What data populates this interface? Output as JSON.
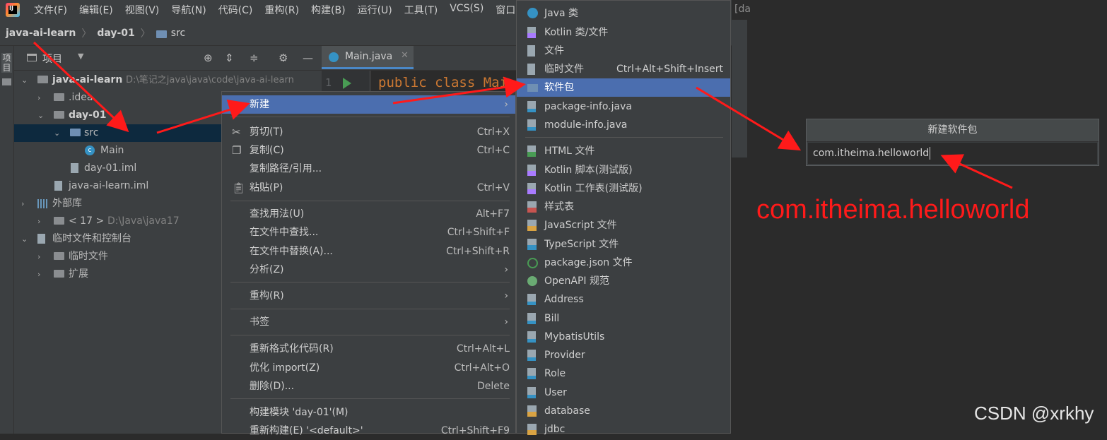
{
  "menubar": {
    "items": [
      "文件(F)",
      "编辑(E)",
      "视图(V)",
      "导航(N)",
      "代码(C)",
      "重构(R)",
      "构建(B)",
      "运行(U)",
      "工具(T)",
      "VCS(S)",
      "窗口"
    ]
  },
  "breadcrumb": {
    "project": "java-ai-learn",
    "module": "day-01",
    "folder": "src"
  },
  "left_strip": {
    "label": "项目"
  },
  "project_panel": {
    "title": "项目",
    "tree": [
      {
        "label": "java-ai-learn",
        "extra": "D:\\笔记之java\\java\\code\\java-ai-learn"
      },
      {
        "label": ".idea"
      },
      {
        "label": "day-01"
      },
      {
        "label": "src"
      },
      {
        "label": "Main"
      },
      {
        "label": "day-01.iml"
      },
      {
        "label": "java-ai-learn.iml"
      },
      {
        "label": "外部库"
      },
      {
        "label": "< 17 >",
        "extra": "D:\\Java\\java17"
      },
      {
        "label": "临时文件和控制台"
      },
      {
        "label": "临时文件"
      },
      {
        "label": "扩展"
      }
    ]
  },
  "editor": {
    "tab_label": "Main.java",
    "line_number": "1",
    "code": "public class Mai"
  },
  "context_menu": {
    "items": [
      {
        "label": "新建",
        "shortcut": ""
      },
      {
        "label": "剪切(T)",
        "shortcut": "Ctrl+X"
      },
      {
        "label": "复制(C)",
        "shortcut": "Ctrl+C"
      },
      {
        "label": "复制路径/引用...",
        "shortcut": ""
      },
      {
        "label": "粘贴(P)",
        "shortcut": "Ctrl+V"
      },
      {
        "label": "查找用法(U)",
        "shortcut": "Alt+F7"
      },
      {
        "label": "在文件中查找...",
        "shortcut": "Ctrl+Shift+F"
      },
      {
        "label": "在文件中替换(A)...",
        "shortcut": "Ctrl+Shift+R"
      },
      {
        "label": "分析(Z)",
        "shortcut": ""
      },
      {
        "label": "重构(R)",
        "shortcut": ""
      },
      {
        "label": "书签",
        "shortcut": ""
      },
      {
        "label": "重新格式化代码(R)",
        "shortcut": "Ctrl+Alt+L"
      },
      {
        "label": "优化 import(Z)",
        "shortcut": "Ctrl+Alt+O"
      },
      {
        "label": "删除(D)...",
        "shortcut": "Delete"
      },
      {
        "label": "构建模块 'day-01'(M)",
        "shortcut": ""
      },
      {
        "label": "重新构建(E) '<default>'",
        "shortcut": "Ctrl+Shift+F9"
      }
    ]
  },
  "new_submenu": {
    "items": [
      {
        "label": "Java 类",
        "shortcut": "",
        "icon": "java-class-icon"
      },
      {
        "label": "Kotlin 类/文件",
        "shortcut": "",
        "icon": "kotlin-file-icon"
      },
      {
        "label": "文件",
        "shortcut": "",
        "icon": "file-icon"
      },
      {
        "label": "临时文件",
        "shortcut": "Ctrl+Alt+Shift+Insert",
        "icon": "scratch-file-icon"
      },
      {
        "label": "软件包",
        "shortcut": "",
        "icon": "package-icon"
      },
      {
        "label": "package-info.java",
        "shortcut": "",
        "icon": "java-file-icon"
      },
      {
        "label": "module-info.java",
        "shortcut": "",
        "icon": "java-file-icon"
      },
      {
        "label": "HTML 文件",
        "shortcut": "",
        "icon": "html-file-icon"
      },
      {
        "label": "Kotlin 脚本(测试版)",
        "shortcut": "",
        "icon": "kotlin-script-icon"
      },
      {
        "label": "Kotlin 工作表(测试版)",
        "shortcut": "",
        "icon": "kotlin-worksheet-icon"
      },
      {
        "label": "样式表",
        "shortcut": "",
        "icon": "css-file-icon"
      },
      {
        "label": "JavaScript 文件",
        "shortcut": "",
        "icon": "js-file-icon"
      },
      {
        "label": "TypeScript 文件",
        "shortcut": "",
        "icon": "ts-file-icon"
      },
      {
        "label": "package.json 文件",
        "shortcut": "",
        "icon": "npm-icon"
      },
      {
        "label": "OpenAPI 规范",
        "shortcut": "",
        "icon": "openapi-icon"
      },
      {
        "label": "Address",
        "shortcut": "",
        "icon": "template-file-icon"
      },
      {
        "label": "Bill",
        "shortcut": "",
        "icon": "template-file-icon"
      },
      {
        "label": "MybatisUtils",
        "shortcut": "",
        "icon": "template-file-icon"
      },
      {
        "label": "Provider",
        "shortcut": "",
        "icon": "template-file-icon"
      },
      {
        "label": "Role",
        "shortcut": "",
        "icon": "template-file-icon"
      },
      {
        "label": "User",
        "shortcut": "",
        "icon": "template-file-icon"
      },
      {
        "label": "database",
        "shortcut": "",
        "icon": "db-file-icon"
      },
      {
        "label": "jdbc",
        "shortcut": "",
        "icon": "db-file-icon"
      }
    ]
  },
  "right_area": {
    "tab_fragment": "[da"
  },
  "dialog": {
    "title": "新建软件包",
    "input_value": "com.itheima.helloworld"
  },
  "annotation": {
    "text": "com.itheima.helloworld",
    "color": "#ff1a1a"
  },
  "watermark": "CSDN @xrkhy",
  "colors": {
    "highlight": "#4b6eaf",
    "selection": "#0d293e",
    "arrow": "#ff1a1a"
  }
}
